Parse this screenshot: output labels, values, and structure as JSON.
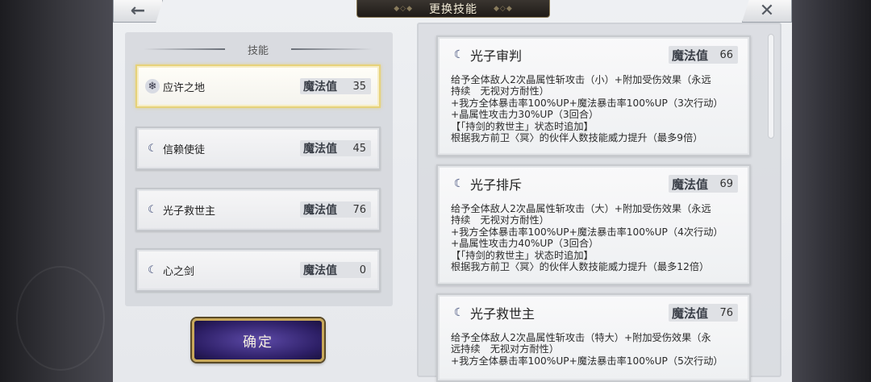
{
  "header": {
    "title": "更换技能",
    "back_icon": "←",
    "close_icon": "✕"
  },
  "left_panel": {
    "title": "技能",
    "skills": [
      {
        "name": "应许之地",
        "mp_label": "魔法值",
        "mp": "35",
        "icon": "snowflake-icon",
        "selected": true
      },
      {
        "name": "信赖使徒",
        "mp_label": "魔法值",
        "mp": "45",
        "icon": "moon-icon",
        "selected": false
      },
      {
        "name": "光子救世主",
        "mp_label": "魔法值",
        "mp": "76",
        "icon": "moon-icon",
        "selected": false
      },
      {
        "name": "心之剑",
        "mp_label": "魔法值",
        "mp": "0",
        "icon": "moon-icon",
        "selected": false
      }
    ],
    "confirm_label": "确定"
  },
  "right_panel": {
    "cards": [
      {
        "name": "光子审判",
        "mp_label": "魔法值",
        "mp": "66",
        "desc": "给予全体敌人2次晶属性斩攻击（小）+附加受伤效果（永远\n持续　无视对方耐性）\n+我方全体暴击率100%UP+魔法暴击率100%UP（3次行动）\n+晶属性攻击力30%UP（3回合）\n【「持剑的救世主」状态时追加】\n根据我方前卫〈冥〉的伙伴人数技能威力提升（最多9倍）"
      },
      {
        "name": "光子排斥",
        "mp_label": "魔法值",
        "mp": "69",
        "desc": "给予全体敌人2次晶属性斩攻击（大）+附加受伤效果（永远\n持续　无视对方耐性）\n+我方全体暴击率100%UP+魔法暴击率100%UP（4次行动）\n+晶属性攻击力40%UP（3回合）\n【「持剑的救世主」状态时追加】\n根据我方前卫〈冥〉的伙伴人数技能威力提升（最多12倍）"
      },
      {
        "name": "光子救世主",
        "mp_label": "魔法值",
        "mp": "76",
        "desc": "给予全体敌人2次晶属性斩攻击（特大）+附加受伤效果（永\n远持续　无视对方耐性）\n+我方全体暴击率100%UP+魔法暴击率100%UP（5次行动）"
      }
    ]
  }
}
